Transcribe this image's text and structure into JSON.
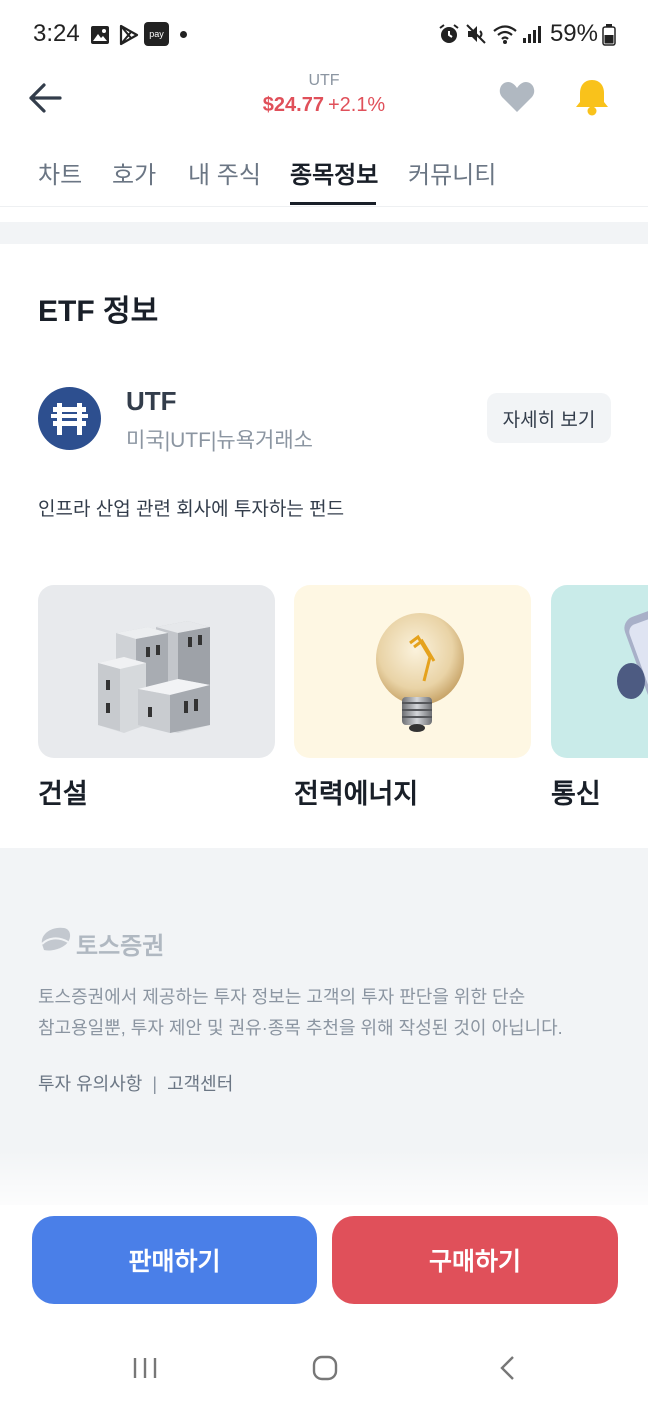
{
  "status_bar": {
    "time": "3:24",
    "battery": "59%",
    "pay_label": "pay"
  },
  "header": {
    "ticker": "UTF",
    "price": "$24.77",
    "change": "+2.1%"
  },
  "tabs": [
    {
      "label": "차트",
      "active": false
    },
    {
      "label": "호가",
      "active": false
    },
    {
      "label": "내 주식",
      "active": false
    },
    {
      "label": "종목정보",
      "active": true
    },
    {
      "label": "커뮤니티",
      "active": false
    }
  ],
  "etf": {
    "section_title": "ETF 정보",
    "name": "UTF",
    "meta": "미국|UTF|뉴욕거래소",
    "detail_button": "자세히 보기",
    "description": "인프라 산업 관련 회사에 투자하는 펀드"
  },
  "categories": [
    {
      "label": "건설",
      "bg": "#e8eaed",
      "icon": "buildings-icon"
    },
    {
      "label": "전력에너지",
      "bg": "#fef7e3",
      "icon": "lightbulb-icon"
    },
    {
      "label": "통신",
      "bg": "#c9ebe9",
      "icon": "phone-icon"
    }
  ],
  "footer": {
    "brand": "토스증권",
    "disclaimer_line1": "토스증권에서 제공하는 투자 정보는 고객의 투자 판단을 위한 단순",
    "disclaimer_line2": "참고용일뿐, 투자 제안 및 권유·종목 추천을 위해 작성된 것이 아닙니다.",
    "link1": "투자 유의사항",
    "separator": "|",
    "link2": "고객센터"
  },
  "actions": {
    "sell": "판매하기",
    "buy": "구매하기"
  },
  "colors": {
    "accent_red": "#e0505a",
    "accent_blue": "#4a7fe8",
    "bell_yellow": "#f9c21b",
    "heart_gray": "#b0b8c1"
  }
}
